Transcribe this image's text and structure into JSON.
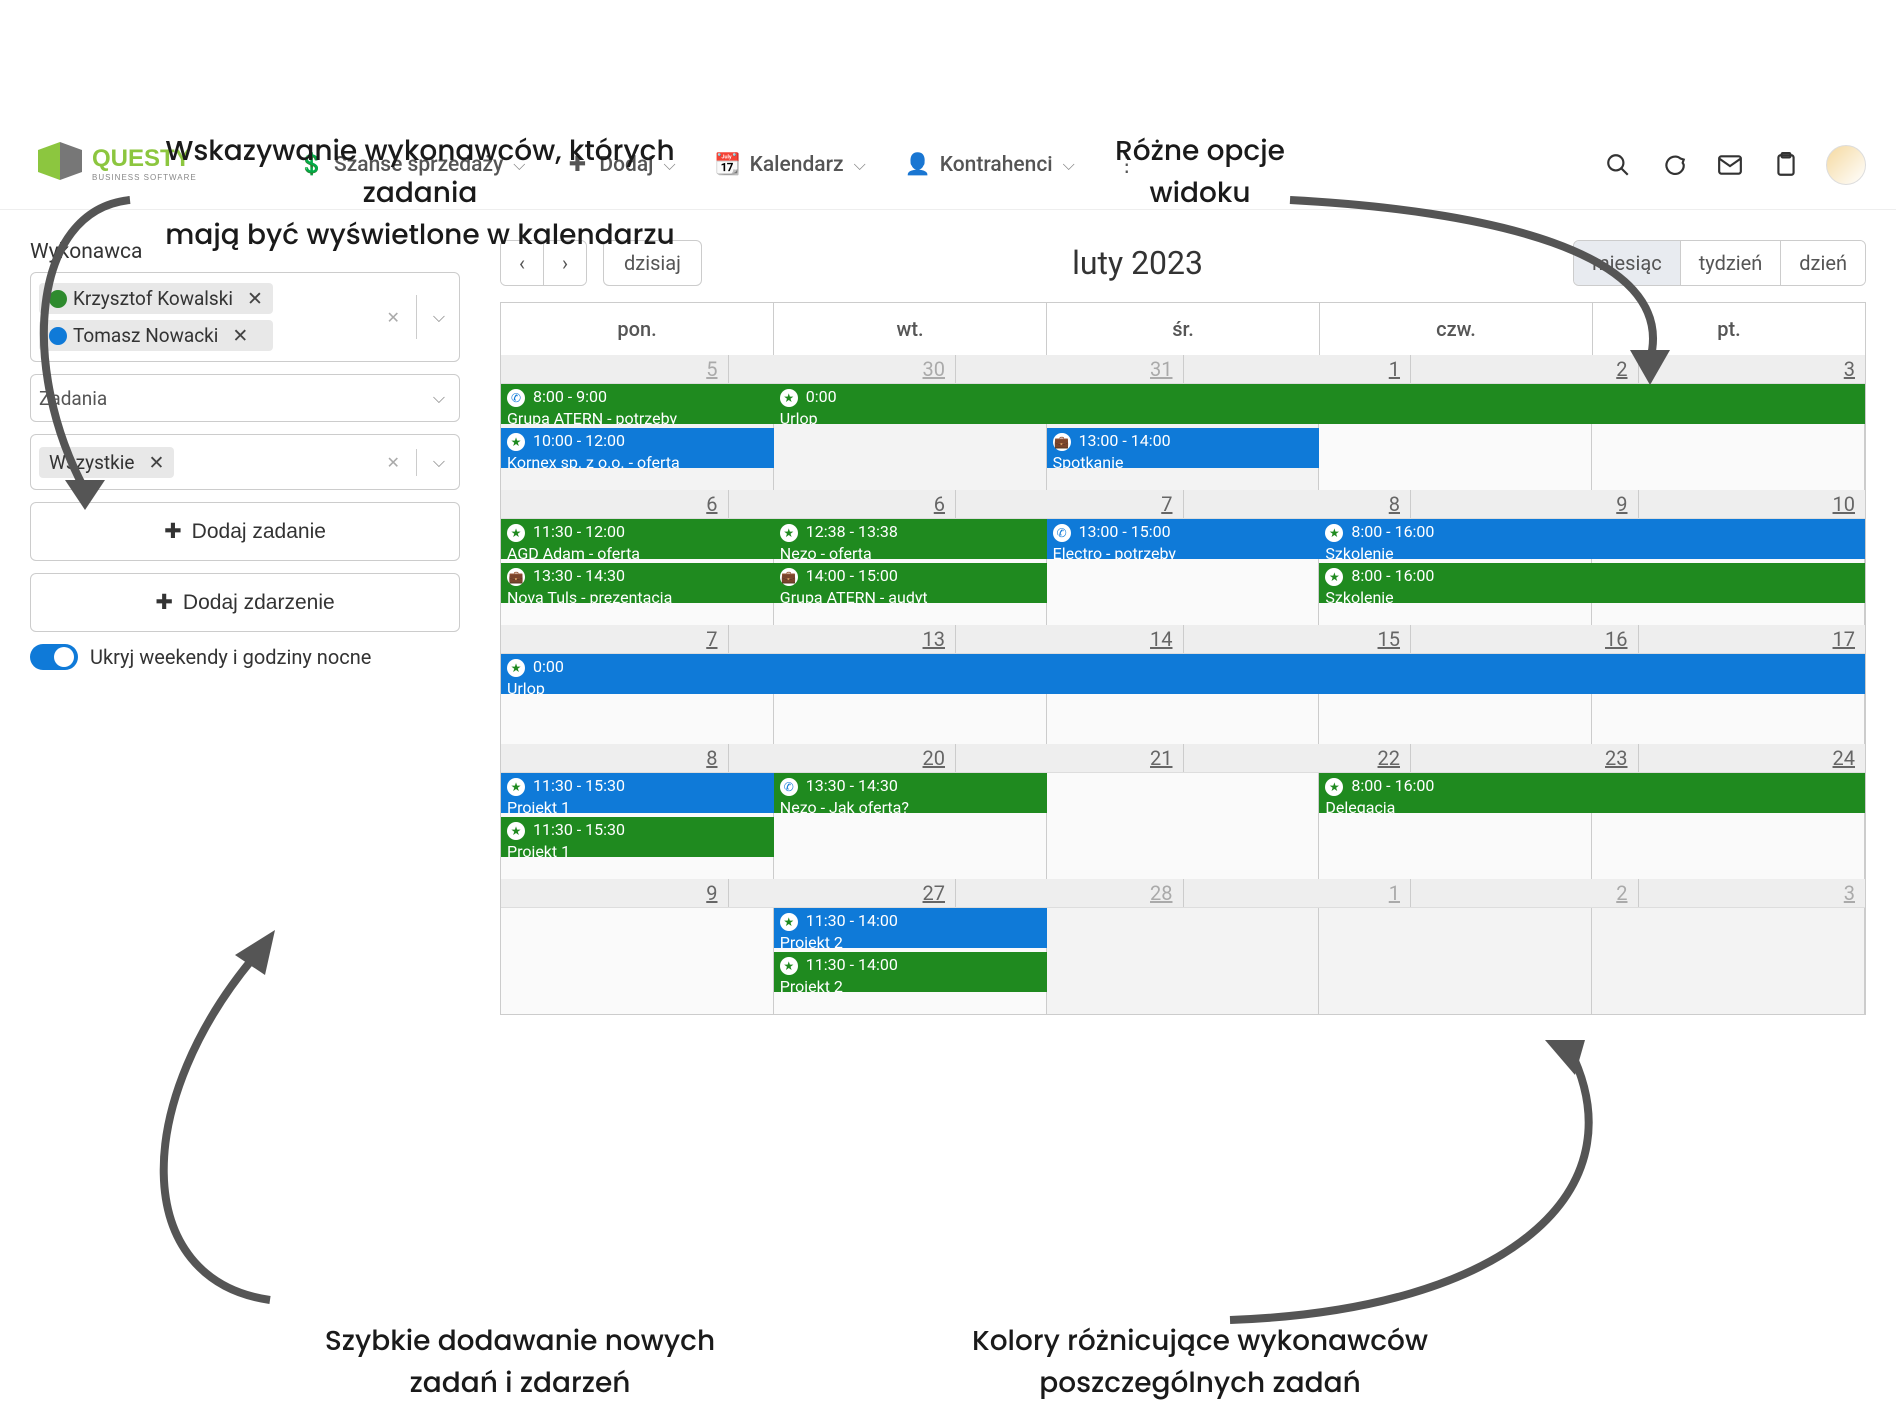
{
  "annotations": {
    "topLeft": "Wskazywanie wykonawców, których zadania\nmają być wyświetlone w kalendarzu",
    "topRight": "Różne opcje\nwidoku",
    "bottomLeft": "Szybkie dodawanie nowych\nzadań i zdarzeń",
    "bottomRight": "Kolory różnicujące wykonawców\nposzczególnych zadań"
  },
  "nav": {
    "szanse": "Szanse sprzedaży",
    "dodaj": "Dodaj",
    "kalendarz": "Kalendarz",
    "kontrahenci": "Kontrahenci"
  },
  "sidebar": {
    "wykonawca_label": "Wykonawca",
    "performers": [
      {
        "name": "Krzysztof Kowalski",
        "color": "green"
      },
      {
        "name": "Tomasz Nowacki",
        "color": "blue"
      }
    ],
    "zadania_label": "Zadania",
    "wszystkie": "Wszystkie",
    "add_task": "Dodaj zadanie",
    "add_event": "Dodaj zdarzenie",
    "toggle_label": "Ukryj weekendy i godziny nocne"
  },
  "calendar": {
    "today": "dzisiaj",
    "title": "luty 2023",
    "views": {
      "month": "miesiąc",
      "week": "tydzień",
      "day": "dzień"
    },
    "days": [
      "pon.",
      "wt.",
      "śr.",
      "czw.",
      "pt."
    ],
    "dates": [
      [
        "5",
        "30",
        "31",
        "1",
        "2",
        "3"
      ],
      [
        "6",
        "6",
        "7",
        "8",
        "9",
        "10"
      ],
      [
        "7",
        "13",
        "14",
        "15",
        "16",
        "17"
      ],
      [
        "8",
        "20",
        "21",
        "22",
        "23",
        "24"
      ],
      [
        "9",
        "27",
        "28",
        "1",
        "2",
        "3"
      ]
    ],
    "events": {
      "w1": [
        {
          "day": 0,
          "span": 1,
          "color": "green",
          "icon": "phone",
          "time": "8:00 - 9:00",
          "label": "Grupa ATERN - potrzeby",
          "row": 0
        },
        {
          "day": 0,
          "span": 1,
          "color": "blue",
          "icon": "star",
          "time": "10:00 - 12:00",
          "label": "Kornex sp. z o.o. - oferta",
          "row": 1
        },
        {
          "day": 1,
          "span": 4,
          "color": "green",
          "icon": "star",
          "time": "0:00",
          "label": "Urlop",
          "row": 0
        },
        {
          "day": 2,
          "span": 1,
          "color": "blue",
          "icon": "brief",
          "time": "13:00 - 14:00",
          "label": "Spotkanie",
          "row": 1
        }
      ],
      "w2": [
        {
          "day": 0,
          "span": 1,
          "color": "green",
          "icon": "star",
          "time": "11:30 - 12:00",
          "label": "AGD Adam - oferta",
          "row": 0
        },
        {
          "day": 0,
          "span": 1,
          "color": "green",
          "icon": "brief",
          "time": "13:30 - 14:30",
          "label": "Nova Tuls - prezentacja",
          "row": 1
        },
        {
          "day": 1,
          "span": 1,
          "color": "green",
          "icon": "star",
          "time": "12:38 - 13:38",
          "label": "Nezo - oferta",
          "row": 0
        },
        {
          "day": 1,
          "span": 1,
          "color": "green",
          "icon": "brief",
          "time": "14:00 - 15:00",
          "label": "Grupa ATERN - audyt",
          "row": 1
        },
        {
          "day": 2,
          "span": 1,
          "color": "blue",
          "icon": "phone",
          "time": "13:00 - 15:00",
          "label": "Electro - potrzeby",
          "row": 0
        },
        {
          "day": 3,
          "span": 2,
          "color": "blue",
          "icon": "star",
          "time": "8:00 - 16:00",
          "label": "Szkolenie",
          "row": 0
        },
        {
          "day": 3,
          "span": 2,
          "color": "green",
          "icon": "star",
          "time": "8:00 - 16:00",
          "label": "Szkolenie",
          "row": 1
        }
      ],
      "w3": [
        {
          "day": 0,
          "span": 5,
          "color": "blue",
          "icon": "star",
          "time": "0:00",
          "label": "Urlop",
          "row": 0
        }
      ],
      "w4": [
        {
          "day": 0,
          "span": 1,
          "color": "blue",
          "icon": "star",
          "time": "11:30 - 15:30",
          "label": "Projekt 1",
          "row": 0
        },
        {
          "day": 0,
          "span": 1,
          "color": "green",
          "icon": "star",
          "time": "11:30 - 15:30",
          "label": "Projekt 1",
          "row": 1
        },
        {
          "day": 1,
          "span": 1,
          "color": "green",
          "icon": "phone",
          "time": "13:30 - 14:30",
          "label": "Nezo - Jak oferta?",
          "row": 0
        },
        {
          "day": 3,
          "span": 2,
          "color": "green",
          "icon": "star",
          "time": "8:00 - 16:00",
          "label": "Delegacja",
          "row": 0
        }
      ],
      "w5": [
        {
          "day": 1,
          "span": 1,
          "color": "blue",
          "icon": "star",
          "time": "11:30 - 14:00",
          "label": "Projekt 2",
          "row": 0
        },
        {
          "day": 1,
          "span": 1,
          "color": "green",
          "icon": "star",
          "time": "11:30 - 14:00",
          "label": "Projekt 2",
          "row": 1
        }
      ]
    }
  }
}
